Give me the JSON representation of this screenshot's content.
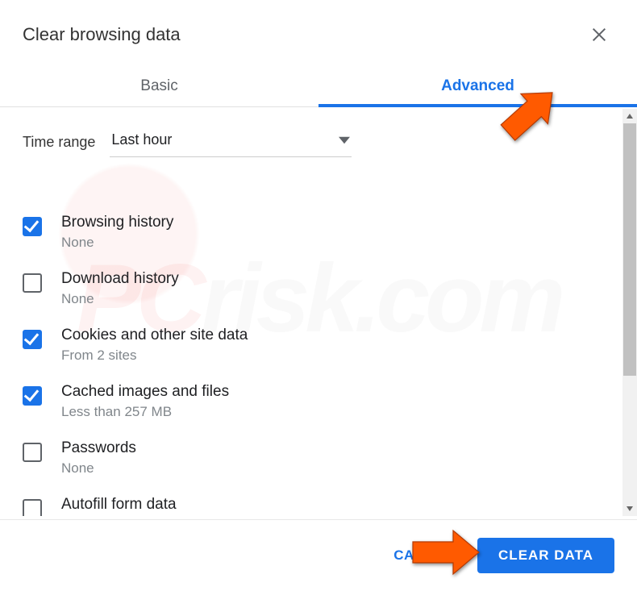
{
  "header": {
    "title": "Clear browsing data"
  },
  "tabs": {
    "basic": "Basic",
    "advanced": "Advanced",
    "active": "advanced"
  },
  "timeRange": {
    "label": "Time range",
    "value": "Last hour"
  },
  "options": [
    {
      "title": "Browsing history",
      "sub": "None",
      "checked": true
    },
    {
      "title": "Download history",
      "sub": "None",
      "checked": false
    },
    {
      "title": "Cookies and other site data",
      "sub": "From 2 sites",
      "checked": true
    },
    {
      "title": "Cached images and files",
      "sub": "Less than 257 MB",
      "checked": true
    },
    {
      "title": "Passwords",
      "sub": "None",
      "checked": false
    },
    {
      "title": "Autofill form data",
      "sub": "",
      "checked": false
    }
  ],
  "footer": {
    "cancel": "CANCEL",
    "clear": "CLEAR DATA"
  }
}
